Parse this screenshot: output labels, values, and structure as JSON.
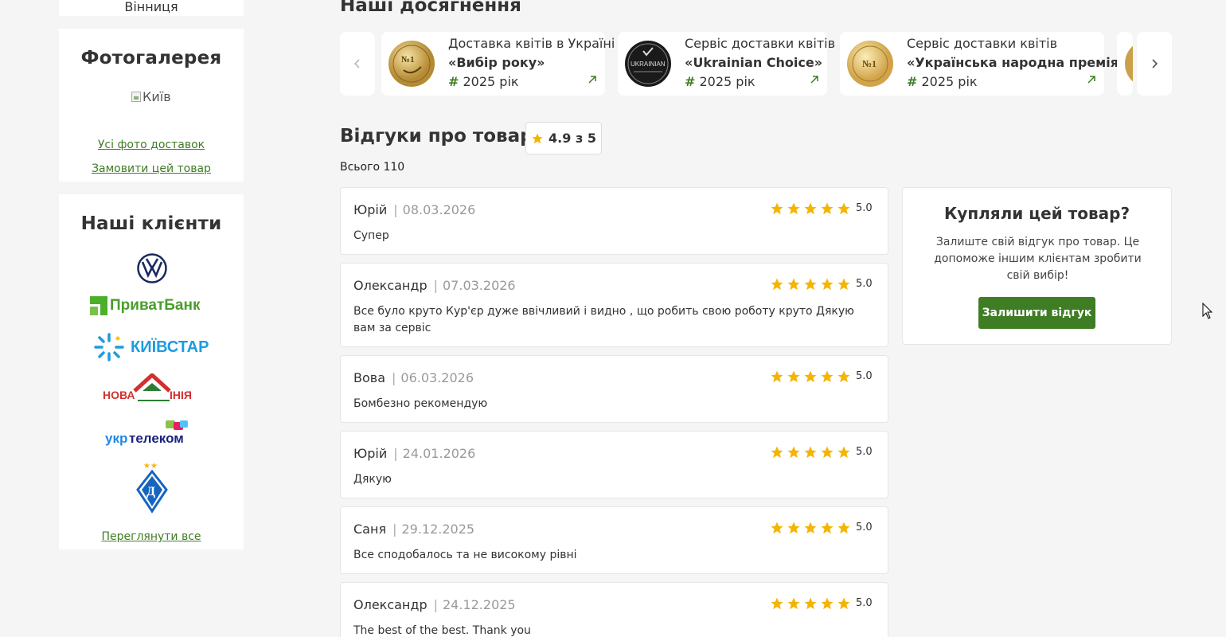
{
  "colors": {
    "brand_green": "#3f7d24",
    "star": "#f5b400",
    "background": "#f5f5f5"
  },
  "sidebar": {
    "city": "Вінниця",
    "gallery": {
      "title": "Фотогалерея",
      "image_alt": "Київ",
      "all_photos_link": "Усі фото доставок",
      "order_link": "Замовити цей товар"
    },
    "clients": {
      "title": "Наші клієнти",
      "logos": [
        {
          "icon": "volkswagen-logo"
        },
        {
          "icon": "privatbank-logo",
          "text": "ПриватБанк"
        },
        {
          "icon": "kyivstar-logo",
          "text": "КИЇВСТАР"
        },
        {
          "icon": "nova-liniya-logo",
          "text": "НОВАЛІНІЯ"
        },
        {
          "icon": "ukrtelecom-logo",
          "text": "укртелеком"
        },
        {
          "icon": "dynamo-kyiv-logo"
        }
      ],
      "view_all_link": "Переглянути все"
    }
  },
  "achievements": {
    "title": "Наші досягнення",
    "items": [
      {
        "line1": "Доставка квітів в Україні",
        "line2": "«Вибір року»",
        "hash": "#",
        "year": " 2025 рік",
        "icon": "gold-medal"
      },
      {
        "line1": "Сервіс доставки квітів",
        "line2": "«Ukrainian Choice»",
        "hash": "#",
        "year": " 2025 рік",
        "icon": "ukrainian-choice-badge",
        "badge_text": "UKRAINIAN"
      },
      {
        "line1": "Сервіс доставки квітів",
        "line2": "«Українська народна премія»",
        "hash": "#",
        "year": " 2025 рік",
        "icon": "gold-medal"
      }
    ]
  },
  "reviews": {
    "title": "Відгуки про товар",
    "rating": "4.9 з 5",
    "total": "Всього 110",
    "items": [
      {
        "author": "Юрій",
        "sep": "|",
        "date": "08.03.2026",
        "stars": 5,
        "score": "5.0",
        "text": "Супер"
      },
      {
        "author": "Олександр",
        "sep": "|",
        "date": "07.03.2026",
        "stars": 5,
        "score": "5.0",
        "text": "Все було круто Кур'єр дуже ввічливий і видно , що робить свою роботу круто Дякую вам за сервіс"
      },
      {
        "author": "Вова",
        "sep": "|",
        "date": "06.03.2026",
        "stars": 5,
        "score": "5.0",
        "text": "Бомбезно рекомендую"
      },
      {
        "author": "Юрій",
        "sep": "|",
        "date": "24.01.2026",
        "stars": 5,
        "score": "5.0",
        "text": "Дякую"
      },
      {
        "author": "Саня",
        "sep": "|",
        "date": "29.12.2025",
        "stars": 5,
        "score": "5.0",
        "text": "Все сподобалось та не високому рівні"
      },
      {
        "author": "Олександр",
        "sep": "|",
        "date": "24.12.2025",
        "stars": 5,
        "score": "5.0",
        "text": "The best of the best. Thank you"
      }
    ]
  },
  "cta": {
    "title": "Купляли цей товар?",
    "text": "Залиште свій відгук про товар. Це допоможе іншим клієнтам зробити свій вибір!",
    "button": "Залишити відгук"
  }
}
